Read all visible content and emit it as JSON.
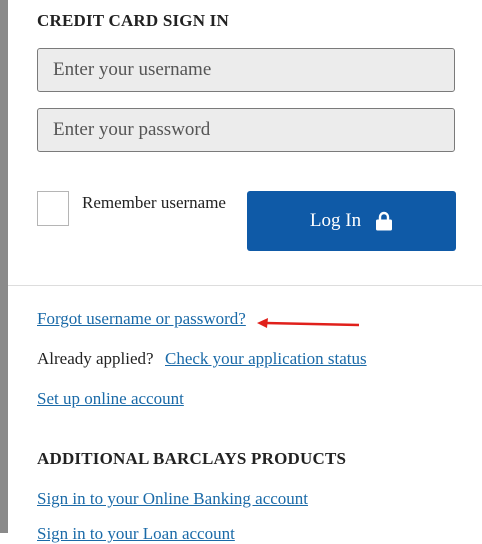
{
  "signin": {
    "heading": "CREDIT CARD SIGN IN",
    "username_placeholder": "Enter your username",
    "password_placeholder": "Enter your password",
    "remember_label": "Remember username",
    "login_label": "Log In",
    "lock_icon": "lock-icon"
  },
  "links": {
    "forgot": "Forgot username or password?",
    "already_applied": "Already applied?",
    "check_status": "Check your application status",
    "setup": "Set up online account"
  },
  "products": {
    "heading": "ADDITIONAL BARCLAYS PRODUCTS",
    "online_banking": "Sign in to your Online Banking account",
    "partial_next": "Sign in to your Loan account"
  },
  "colors": {
    "button": "#0f5aa7",
    "link": "#1a6aa8",
    "annotation_arrow": "#e0201b"
  }
}
